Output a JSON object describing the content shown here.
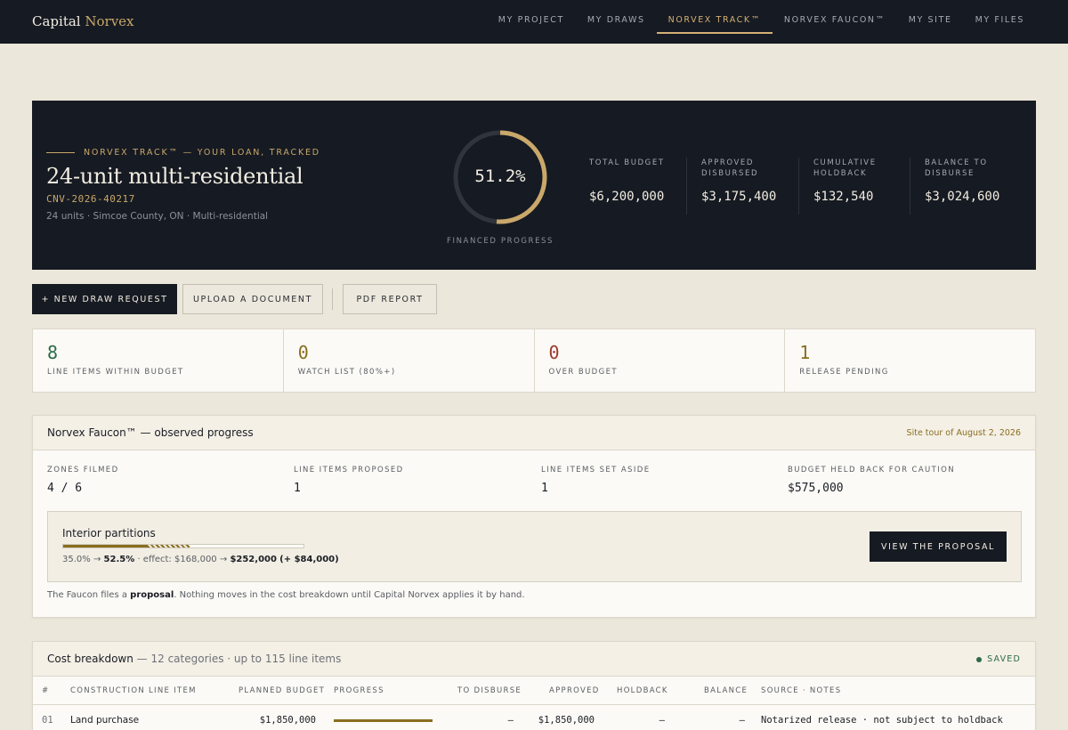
{
  "nav": {
    "brand_a": "Capital",
    "brand_b": "Norvex",
    "links": [
      "MY PROJECT",
      "MY DRAWS",
      "NORVEX TRACK™",
      "NORVEX FAUCON™",
      "MY SITE",
      "MY FILES"
    ],
    "active_index": 2
  },
  "hero": {
    "eyebrow": "NORVEX TRACK™ — YOUR LOAN, TRACKED",
    "title": "24-unit multi-residential",
    "code": "CNV-2026-40217",
    "meta": "24 units · Simcoe County, ON · Multi-residential",
    "progress_value": "51.2%",
    "progress_fraction": 0.512,
    "progress_label": "FINANCED PROGRESS",
    "stats": [
      {
        "label_1": "TOTAL BUDGET",
        "label_2": "",
        "value": "$6,200,000"
      },
      {
        "label_1": "APPROVED",
        "label_2": "DISBURSED",
        "value": "$3,175,400"
      },
      {
        "label_1": "CUMULATIVE",
        "label_2": "HOLDBACK",
        "value": "$132,540"
      },
      {
        "label_1": "BALANCE TO",
        "label_2": "DISBURSE",
        "value": "$3,024,600"
      }
    ]
  },
  "actions": {
    "new_draw": "+ NEW DRAW REQUEST",
    "upload": "UPLOAD A DOCUMENT",
    "pdf": "PDF REPORT"
  },
  "kpis": [
    {
      "value": "8",
      "label": "LINE ITEMS WITHIN BUDGET",
      "color": "#2d6a4a"
    },
    {
      "value": "0",
      "label": "WATCH LIST (80%+)",
      "color": "#8a6d1f"
    },
    {
      "value": "0",
      "label": "OVER BUDGET",
      "color": "#a0392b"
    },
    {
      "value": "1",
      "label": "RELEASE PENDING",
      "color": "#8a6d1f"
    }
  ],
  "faucon": {
    "title": "Norvex Faucon™ — observed progress",
    "tour": "Site tour of August 2, 2026",
    "stats": [
      {
        "label": "ZONES FILMED",
        "value": "4 / 6"
      },
      {
        "label": "LINE ITEMS PROPOSED",
        "value": "1"
      },
      {
        "label": "LINE ITEMS SET ASIDE",
        "value": "1"
      },
      {
        "label": "BUDGET HELD BACK FOR CAUTION",
        "value": "$575,000"
      }
    ],
    "proposal": {
      "title": "Interior partitions",
      "from_pct": "35.0%",
      "arrow": "→",
      "to_pct": "52.5%",
      "effect_label": "· effect: $168,000",
      "to_amount": "$252,000",
      "delta": "(+ $84,000)",
      "from_fraction": 0.35,
      "to_fraction": 0.525,
      "button": "VIEW THE PROPOSAL"
    },
    "note_a": "The Faucon files a",
    "note_bold": "proposal",
    "note_b": ". Nothing moves in the cost breakdown until Capital Norvex applies it by hand."
  },
  "cost": {
    "title": "Cost breakdown",
    "subtitle": "— 12 categories · up to 115 line items",
    "saved": "SAVED",
    "columns": [
      "#",
      "CONSTRUCTION LINE ITEM",
      "PLANNED BUDGET",
      "PROGRESS",
      "TO DISBURSE",
      "APPROVED",
      "HOLDBACK",
      "BALANCE",
      "SOURCE · NOTES"
    ],
    "rows": [
      {
        "num": "01",
        "item": "Land purchase",
        "planned": "$1,850,000",
        "progress_fraction": 1.0,
        "to_disburse": "—",
        "approved": "$1,850,000",
        "holdback": "—",
        "balance": "—",
        "notes": "Notarized release · not subject to holdback"
      }
    ]
  }
}
